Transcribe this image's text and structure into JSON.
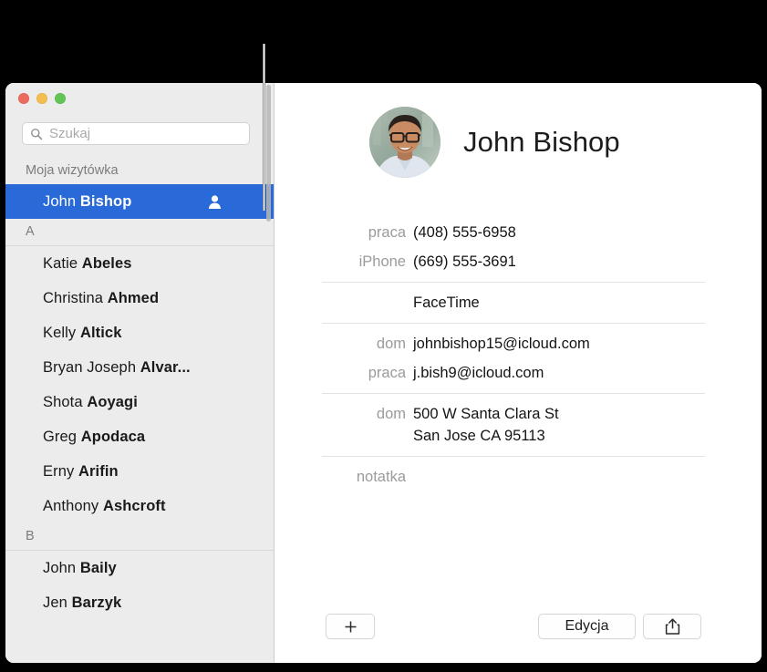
{
  "callout": {
    "name": "callout-line"
  },
  "window": {
    "traffic_lights": [
      {
        "name": "close-button",
        "color": "#ec6a5e"
      },
      {
        "name": "minimize-button",
        "color": "#f4bd4f"
      },
      {
        "name": "maximize-button",
        "color": "#61c455"
      }
    ]
  },
  "search": {
    "placeholder": "Szukaj",
    "value": "",
    "icon": "search-icon"
  },
  "sidebar": {
    "groups": [
      {
        "header": "Moja wizytówka",
        "ruled": false,
        "contacts": [
          {
            "given": "John ",
            "family": "Bishop",
            "selected": true,
            "trailing_icon": "person-icon"
          }
        ]
      },
      {
        "header": "A",
        "ruled": true,
        "contacts": [
          {
            "given": "Katie ",
            "family": "Abeles",
            "selected": false
          },
          {
            "given": "Christina ",
            "family": "Ahmed",
            "selected": false
          },
          {
            "given": "Kelly ",
            "family": "Altick",
            "selected": false
          },
          {
            "given": "Bryan Joseph ",
            "family": "Alvar...",
            "selected": false
          },
          {
            "given": "Shota ",
            "family": "Aoyagi",
            "selected": false
          },
          {
            "given": "Greg ",
            "family": "Apodaca",
            "selected": false
          },
          {
            "given": "Erny ",
            "family": "Arifin",
            "selected": false
          },
          {
            "given": "Anthony ",
            "family": "Ashcroft",
            "selected": false
          }
        ]
      },
      {
        "header": "B",
        "ruled": true,
        "contacts": [
          {
            "given": "John ",
            "family": "Baily",
            "selected": false
          },
          {
            "given": "Jen ",
            "family": "Barzyk",
            "selected": false
          }
        ]
      }
    ],
    "selection_color": "#2a69d8",
    "background_color": "#ececec"
  },
  "detail": {
    "name": "John Bishop",
    "avatar_alt": "contact-photo",
    "fields": [
      {
        "label": "praca",
        "value": "(408) 555-6958",
        "sep_after": false
      },
      {
        "label": "iPhone",
        "value": "(669) 555-3691",
        "sep_after": true
      },
      {
        "label": "",
        "value": "FaceTime",
        "sep_after": true
      },
      {
        "label": "dom",
        "value": "johnbishop15@icloud.com",
        "sep_after": false
      },
      {
        "label": "praca",
        "value": "j.bish9@icloud.com",
        "sep_after": true
      },
      {
        "label": "dom",
        "value": "500 W Santa Clara St\nSan Jose CA 95113",
        "sep_after": true
      },
      {
        "label": "notatka",
        "value": "",
        "sep_after": false
      }
    ]
  },
  "toolbar": {
    "add_label": "+",
    "edit_label": "Edycja",
    "share_label": "",
    "add_icon": "plus-icon",
    "share_icon": "share-icon"
  }
}
